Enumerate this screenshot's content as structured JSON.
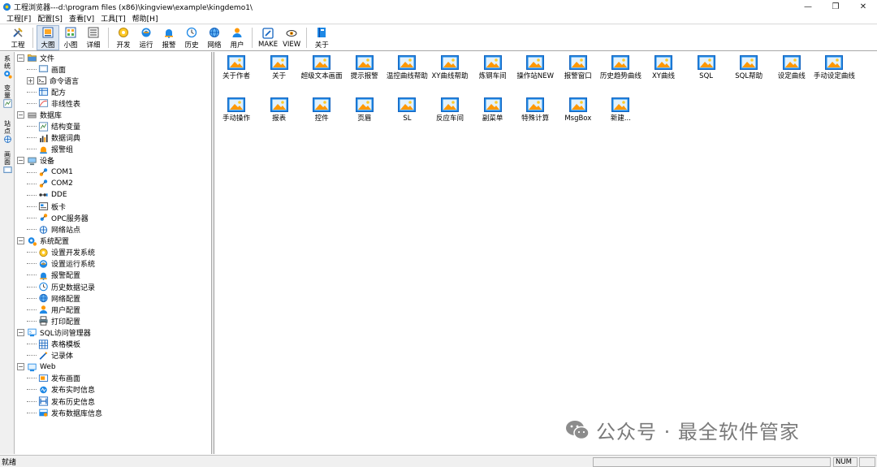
{
  "window": {
    "title": "工程浏览器---d:\\program files (x86)\\kingview\\example\\kingdemo1\\",
    "minimize": "—",
    "restore": "❐",
    "close": "✕"
  },
  "menu": [
    "工程[F]",
    "配置[S]",
    "查看[V]",
    "工具[T]",
    "帮助[H]"
  ],
  "toolbar": [
    {
      "label": "工程",
      "icon": "tools-icon"
    },
    {
      "label": "大图",
      "icon": "large-icon-view-icon",
      "active": true
    },
    {
      "label": "小图",
      "icon": "small-icon-view-icon"
    },
    {
      "label": "详细",
      "icon": "details-view-icon"
    },
    {
      "label": "开发",
      "icon": "develop-icon"
    },
    {
      "label": "运行",
      "icon": "run-icon"
    },
    {
      "label": "报警",
      "icon": "alarm-bell-icon"
    },
    {
      "label": "历史",
      "icon": "history-icon"
    },
    {
      "label": "网络",
      "icon": "network-globe-icon"
    },
    {
      "label": "用户",
      "icon": "user-icon"
    },
    {
      "label": "MAKE",
      "icon": "make-icon"
    },
    {
      "label": "VIEW",
      "icon": "view-icon"
    },
    {
      "label": "关于",
      "icon": "about-book-icon"
    }
  ],
  "vtabs": [
    "系统",
    "变量",
    "站点",
    "画面"
  ],
  "tree": [
    {
      "label": "文件",
      "level": 0,
      "exp": "⊟",
      "icon": "folder-icon"
    },
    {
      "label": "画面",
      "level": 1,
      "icon": "screen-icon"
    },
    {
      "label": "命令语言",
      "level": 1,
      "exp": "⊞",
      "icon": "command-icon"
    },
    {
      "label": "配方",
      "level": 1,
      "icon": "recipe-icon"
    },
    {
      "label": "非线性表",
      "level": 1,
      "icon": "nonlinear-table-icon"
    },
    {
      "label": "数据库",
      "level": 0,
      "exp": "⊟",
      "icon": "database-icon"
    },
    {
      "label": "结构变量",
      "level": 1,
      "icon": "struct-variable-icon"
    },
    {
      "label": "数据词典",
      "level": 1,
      "icon": "data-dictionary-icon"
    },
    {
      "label": "报警组",
      "level": 1,
      "icon": "alarm-group-icon"
    },
    {
      "label": "设备",
      "level": 0,
      "exp": "⊟",
      "icon": "device-icon"
    },
    {
      "label": "COM1",
      "level": 1,
      "icon": "com-port-icon"
    },
    {
      "label": "COM2",
      "level": 1,
      "icon": "com-port-icon"
    },
    {
      "label": "DDE",
      "level": 1,
      "icon": "dde-icon"
    },
    {
      "label": "板卡",
      "level": 1,
      "icon": "board-card-icon"
    },
    {
      "label": "OPC服务器",
      "level": 1,
      "icon": "opc-server-icon"
    },
    {
      "label": "网络站点",
      "level": 1,
      "icon": "network-site-icon"
    },
    {
      "label": "系统配置",
      "level": 0,
      "exp": "⊟",
      "icon": "system-config-icon"
    },
    {
      "label": "设置开发系统",
      "level": 1,
      "icon": "develop-icon"
    },
    {
      "label": "设置运行系统",
      "level": 1,
      "icon": "run-icon"
    },
    {
      "label": "报警配置",
      "level": 1,
      "icon": "alarm-bell-icon"
    },
    {
      "label": "历史数据记录",
      "level": 1,
      "icon": "history-icon"
    },
    {
      "label": "网络配置",
      "level": 1,
      "icon": "network-globe-icon"
    },
    {
      "label": "用户配置",
      "level": 1,
      "icon": "user-icon"
    },
    {
      "label": "打印配置",
      "level": 1,
      "icon": "print-icon"
    },
    {
      "label": "SQL访问管理器",
      "level": 0,
      "exp": "⊟",
      "icon": "sql-manager-icon"
    },
    {
      "label": "表格模板",
      "level": 1,
      "icon": "table-template-icon"
    },
    {
      "label": "记录体",
      "level": 1,
      "icon": "record-icon"
    },
    {
      "label": "Web",
      "level": 0,
      "exp": "⊟",
      "icon": "web-icon"
    },
    {
      "label": "发布画面",
      "level": 1,
      "icon": "publish-screen-icon"
    },
    {
      "label": "发布实时信息",
      "level": 1,
      "icon": "publish-realtime-icon"
    },
    {
      "label": "发布历史信息",
      "level": 1,
      "icon": "publish-history-icon"
    },
    {
      "label": "发布数据库信息",
      "level": 1,
      "icon": "publish-database-icon"
    }
  ],
  "items": [
    "关于作者",
    "关于",
    "超级文本画面",
    "提示报警",
    "温控曲线帮助",
    "XY曲线帮助",
    "炼钢车间",
    "操作站NEW",
    "报警窗口",
    "历史趋势曲线",
    "XY曲线",
    "SQL",
    "SQL帮助",
    "设定曲线",
    "手动设定曲线",
    "手动操作",
    "报表",
    "控件",
    "页眉",
    "SL",
    "反应车间",
    "副菜单",
    "特殊计算",
    "MsgBox",
    "新建..."
  ],
  "status": {
    "text": "就绪",
    "num": "NUM"
  },
  "watermark": "公众号 · 最全软件管家"
}
